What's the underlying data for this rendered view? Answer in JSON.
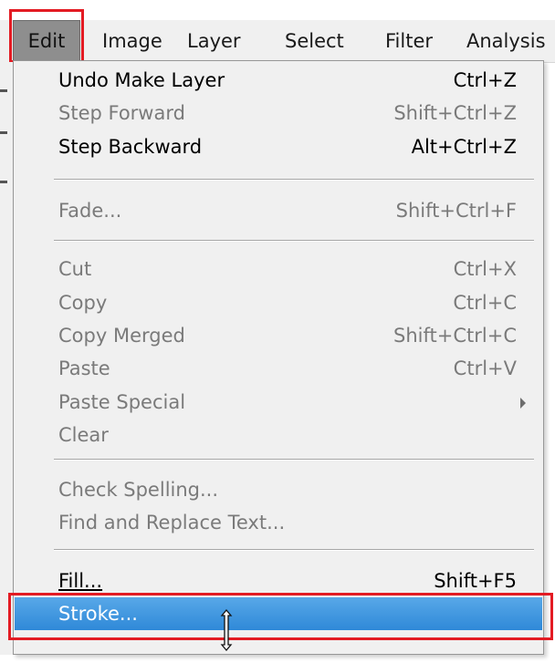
{
  "menubar": {
    "items": [
      {
        "label": "Edit",
        "active": true
      },
      {
        "label": "Image"
      },
      {
        "label": "Layer"
      },
      {
        "label": "Select"
      },
      {
        "label": "Filter"
      },
      {
        "label": "Analysis"
      }
    ]
  },
  "edit_menu": {
    "items": [
      {
        "label": "Undo Make Layer",
        "shortcut": "Ctrl+Z",
        "enabled": true
      },
      {
        "label": "Step Forward",
        "shortcut": "Shift+Ctrl+Z",
        "enabled": false
      },
      {
        "label": "Step Backward",
        "shortcut": "Alt+Ctrl+Z",
        "enabled": true
      },
      {
        "label": "Fade...",
        "shortcut": "Shift+Ctrl+F",
        "enabled": false
      },
      {
        "label": "Cut",
        "shortcut": "Ctrl+X",
        "enabled": false
      },
      {
        "label": "Copy",
        "shortcut": "Ctrl+C",
        "enabled": false
      },
      {
        "label": "Copy Merged",
        "shortcut": "Shift+Ctrl+C",
        "enabled": false
      },
      {
        "label": "Paste",
        "shortcut": "Ctrl+V",
        "enabled": false
      },
      {
        "label": "Paste Special",
        "shortcut": "",
        "enabled": false,
        "submenu": true
      },
      {
        "label": "Clear",
        "shortcut": "",
        "enabled": false
      },
      {
        "label": "Check Spelling...",
        "shortcut": "",
        "enabled": false
      },
      {
        "label": "Find and Replace Text...",
        "shortcut": "",
        "enabled": false
      },
      {
        "label": "Fill...",
        "shortcut": "Shift+F5",
        "enabled": true
      },
      {
        "label": "Stroke...",
        "shortcut": "",
        "enabled": true,
        "selected": true
      }
    ]
  },
  "colors": {
    "highlight_box": "#e31b23",
    "selected_item": "#3391dc",
    "menu_background": "#f0f0f0",
    "disabled_text": "#7a7a7a"
  },
  "icons": {
    "cursor": "i-beam-resize-cursor-icon",
    "submenu": "submenu-arrow-icon"
  }
}
